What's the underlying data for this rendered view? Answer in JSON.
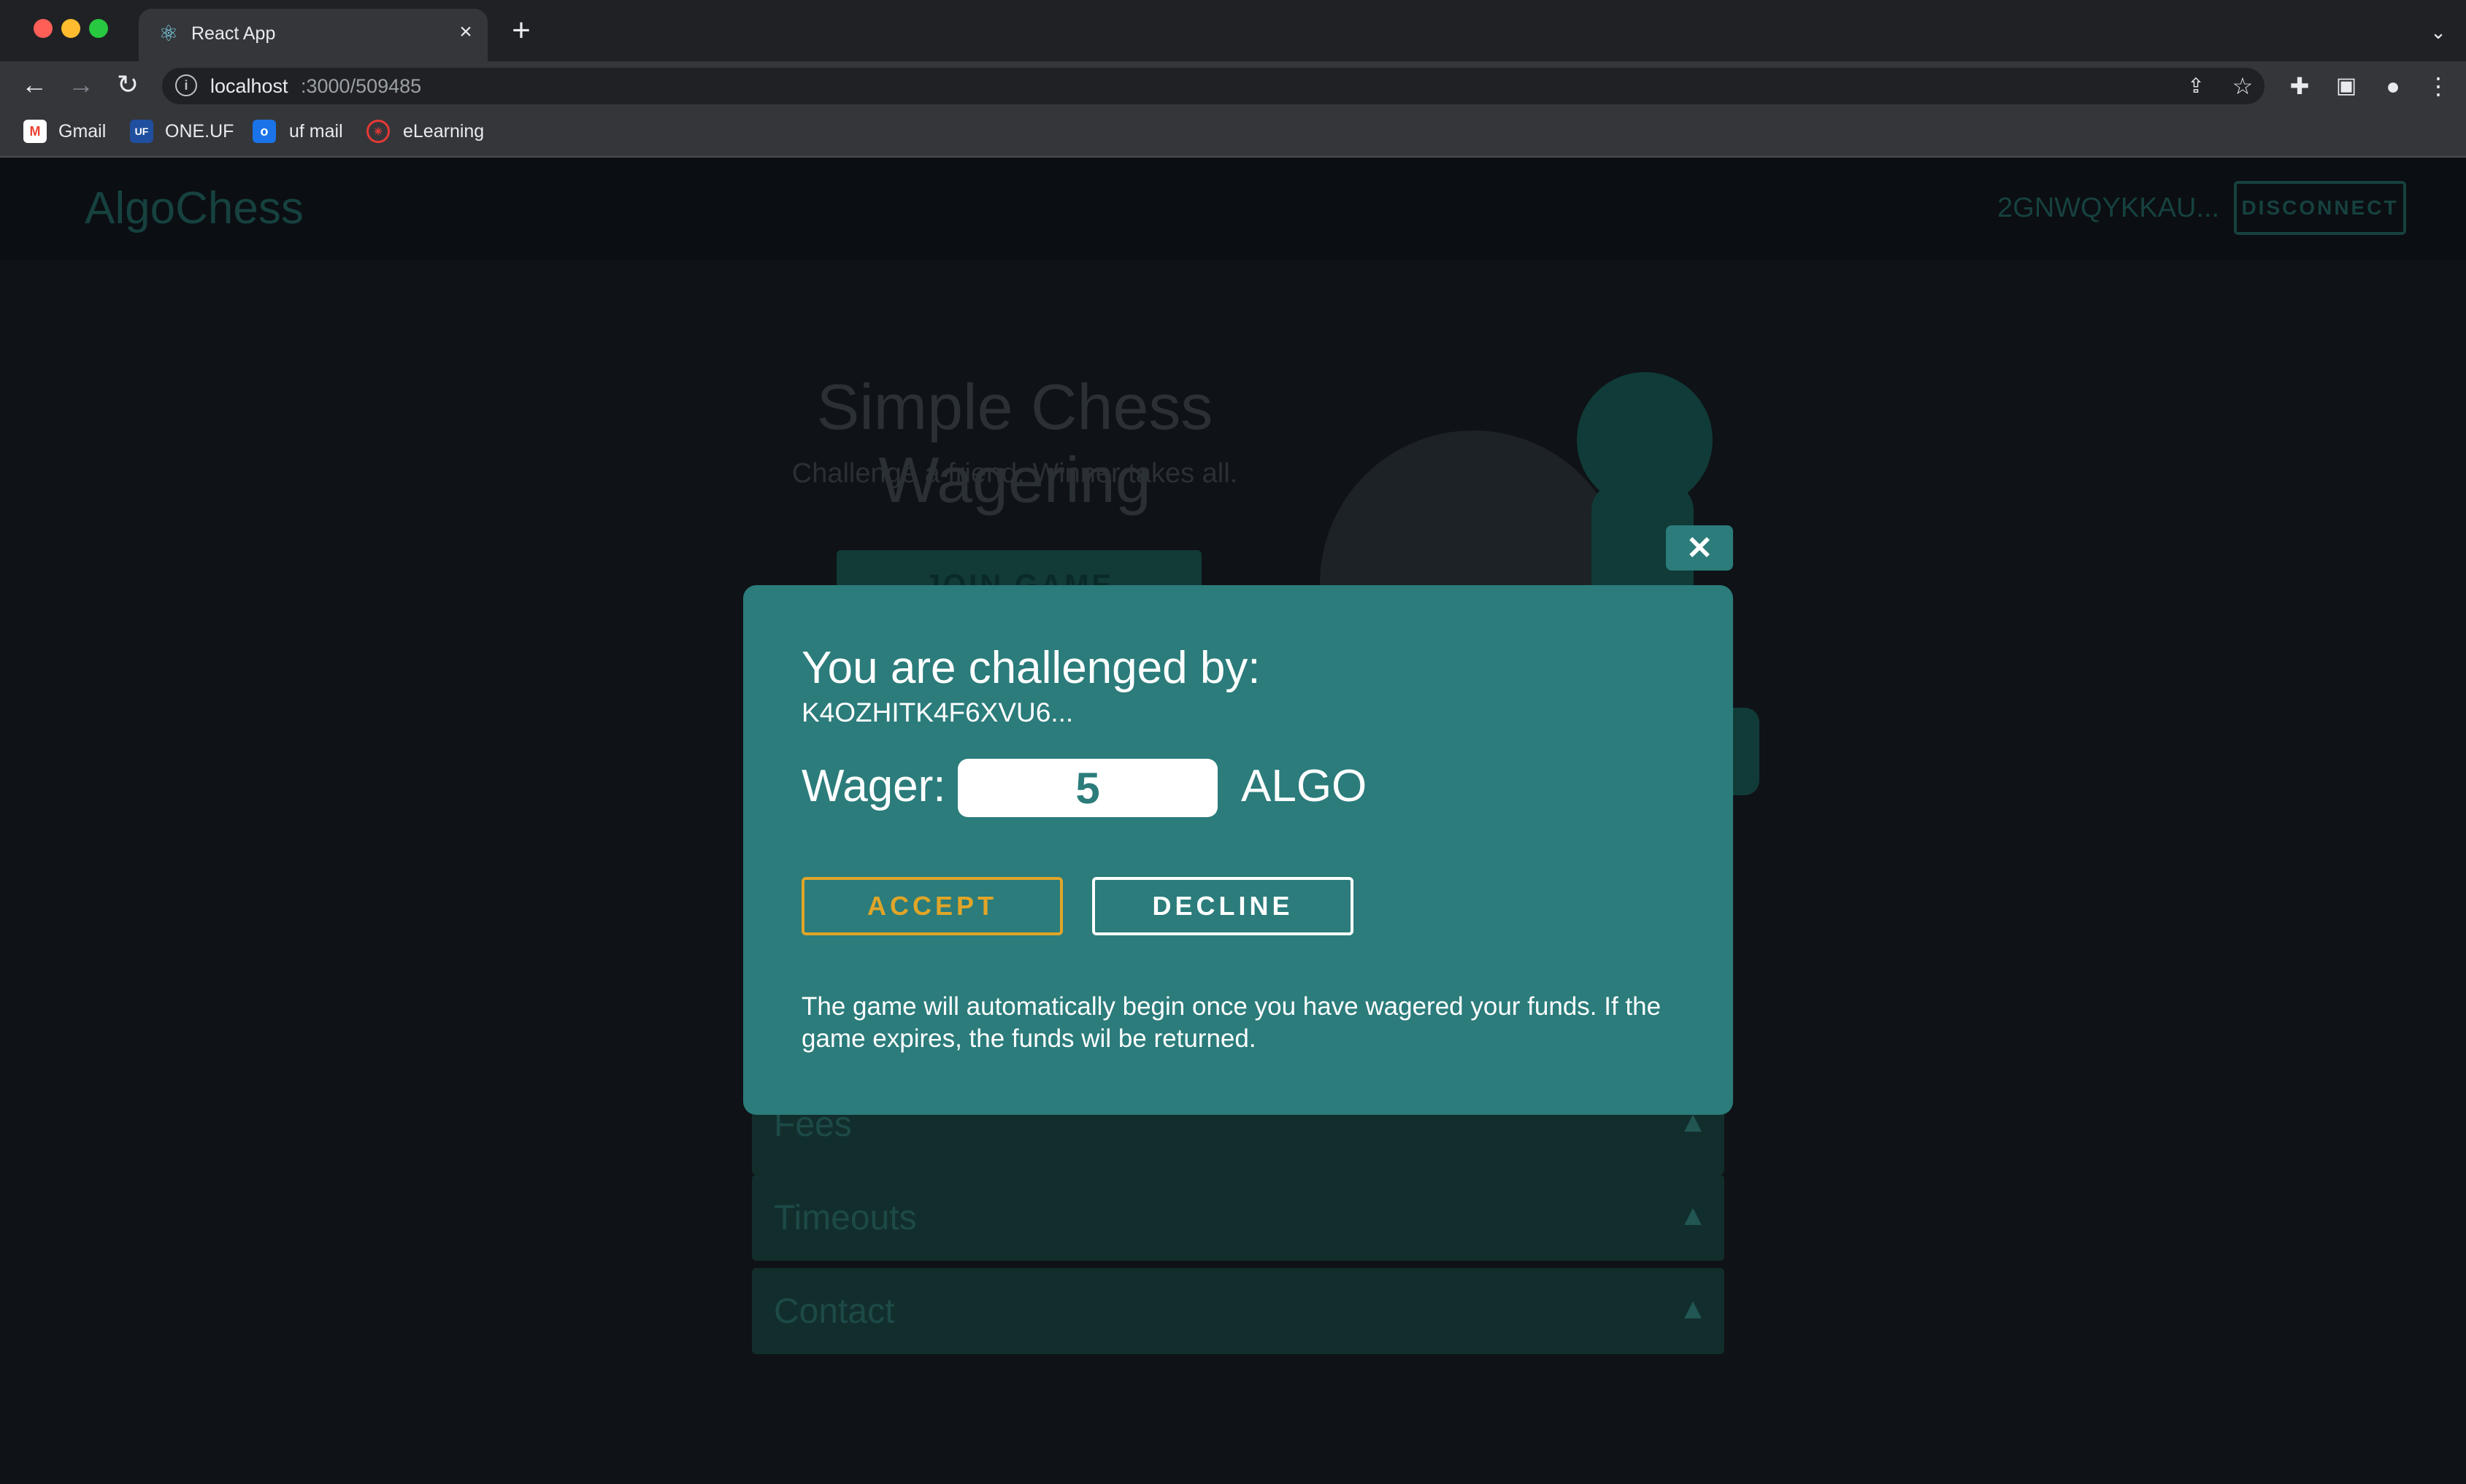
{
  "browser": {
    "tab_title": "React App",
    "url_host": "localhost",
    "url_path": ":3000/509485",
    "bookmarks": [
      {
        "label": "Gmail",
        "icon": "gmail-icon"
      },
      {
        "label": "ONE.UF",
        "icon": "one-uf-icon"
      },
      {
        "label": "uf mail",
        "icon": "outlook-icon"
      },
      {
        "label": "eLearning",
        "icon": "elearning-icon"
      }
    ]
  },
  "header": {
    "logo": "AlgoChess",
    "account": "2GNWQYKKAU...",
    "disconnect_label": "DISCONNECT"
  },
  "hero": {
    "title": "Simple Chess Wagering",
    "subtitle": "Challenge a friend. Winner takes all.",
    "join_label": "JOIN GAME"
  },
  "faq": {
    "items": [
      "Fees",
      "Timeouts",
      "Contact"
    ]
  },
  "modal": {
    "close_glyph": "✕",
    "title": "You are challenged by:",
    "challenger": "K4OZHITK4F6XVU6...",
    "wager_label": "Wager:",
    "wager_value": "5",
    "wager_unit": "ALGO",
    "accept_label": "ACCEPT",
    "decline_label": "DECLINE",
    "note": "The game will automatically begin once you have wagered your funds. If the game expires, the funds wil be returned."
  },
  "colors": {
    "modal_bg": "#2b7c7b",
    "accept": "#e0a528",
    "page_bg": "#0f1216"
  }
}
